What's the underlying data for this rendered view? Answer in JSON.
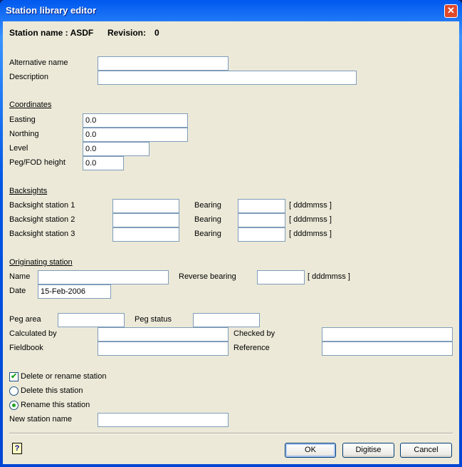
{
  "window": {
    "title": "Station library editor",
    "close": "✕"
  },
  "header": {
    "station_name": "Station name : ASDF",
    "revision_label": "Revision:",
    "revision": "0"
  },
  "alt_name_label": "Alternative name",
  "description_label": "Description",
  "coordinates": {
    "heading": "Coordinates",
    "easting_label": "Easting",
    "easting": "0.0",
    "northing_label": "Northing",
    "northing": "0.0",
    "level_label": "Level",
    "level": "0.0",
    "peg_label": "Peg/FOD height",
    "peg": "0.0"
  },
  "backsights": {
    "heading": "Backsights",
    "rows": [
      {
        "label": "Backsight station 1",
        "bearing": "Bearing",
        "unit": "[ dddmmss ]"
      },
      {
        "label": "Backsight station 2",
        "bearing": "Bearing",
        "unit": "[ dddmmss ]"
      },
      {
        "label": "Backsight station 3",
        "bearing": "Bearing",
        "unit": "[ dddmmss ]"
      }
    ]
  },
  "originating": {
    "heading": "Originating station",
    "name_label": "Name",
    "reverse_label": "Reverse bearing",
    "unit": "[ dddmmss ]",
    "date_label": "Date",
    "date": "15-Feb-2006"
  },
  "peg": {
    "area_label": "Peg area",
    "status_label": "Peg status",
    "calc_label": "Calculated by",
    "checked_label": "Checked by",
    "fieldbook_label": "Fieldbook",
    "reference_label": "Reference"
  },
  "options": {
    "delete_rename": "Delete or rename station",
    "delete_rename_checked": true,
    "delete": "Delete this station",
    "rename": "Rename this station",
    "selected": "rename",
    "new_name_label": "New station name"
  },
  "footer": {
    "help": "?",
    "ok": "OK",
    "digitise": "Digitise",
    "cancel": "Cancel"
  }
}
